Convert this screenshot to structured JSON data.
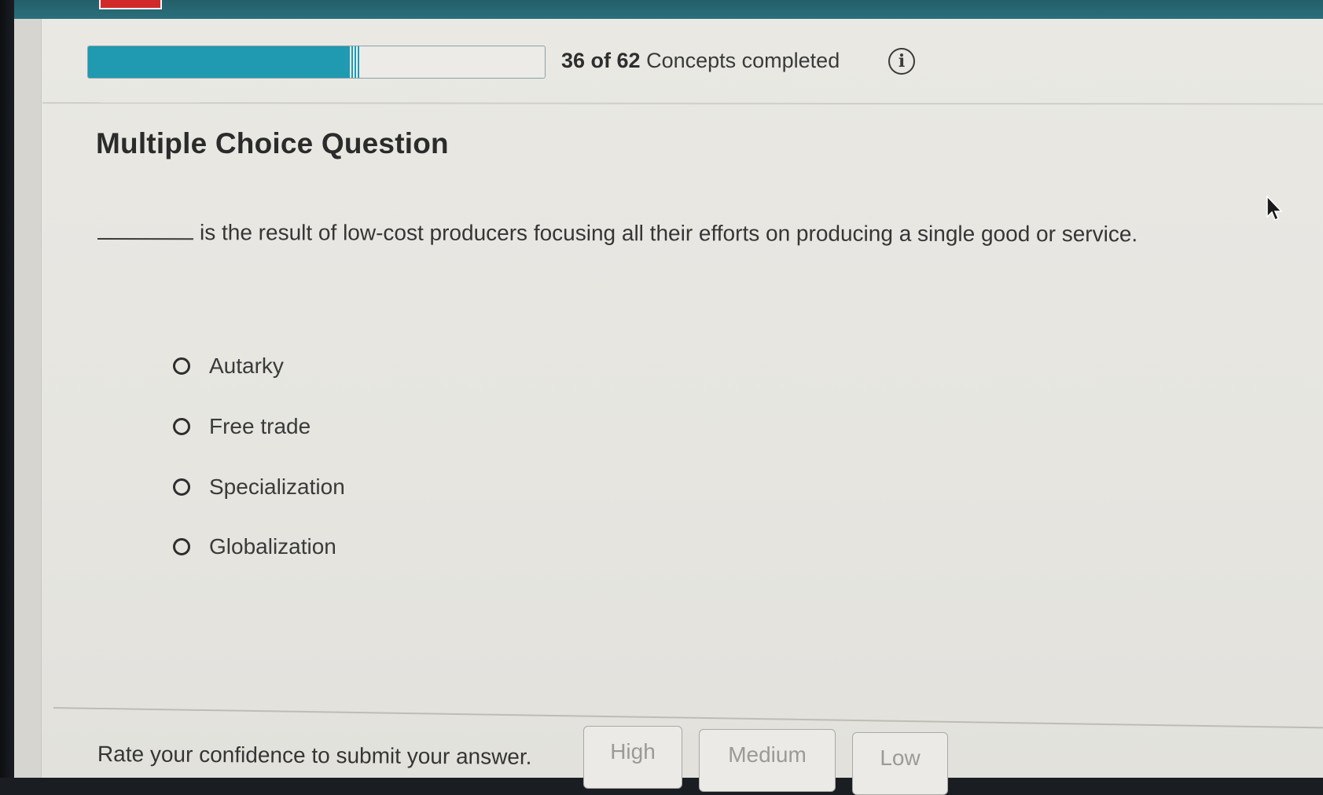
{
  "progress": {
    "completed": 36,
    "total": 62,
    "count_text": "36 of 62",
    "label": "Concepts completed",
    "info_icon": "info-icon"
  },
  "question": {
    "type_heading": "Multiple Choice Question",
    "text": "is the result of low-cost producers focusing all their efforts on producing a single good or service.",
    "choices": [
      {
        "label": "Autarky",
        "selected": false
      },
      {
        "label": "Free trade",
        "selected": false
      },
      {
        "label": "Specialization",
        "selected": false
      },
      {
        "label": "Globalization",
        "selected": false
      }
    ]
  },
  "confidence": {
    "prompt": "Rate your confidence to submit your answer.",
    "buttons": [
      "High",
      "Medium",
      "Low"
    ]
  },
  "colors": {
    "accent": "#1f9ab0",
    "top_bar": "#2a6f7b",
    "logo": "#d22a2a"
  }
}
